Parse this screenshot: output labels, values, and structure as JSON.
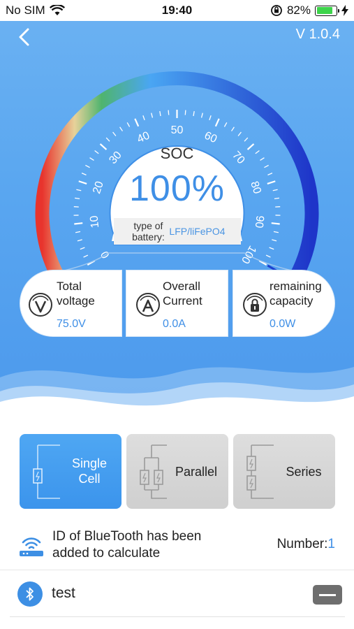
{
  "status_bar": {
    "carrier": "No SIM",
    "time": "19:40",
    "battery_percent": "82%",
    "battery_level": 0.82
  },
  "header": {
    "version": "V 1.0.4",
    "back_icon": "chevron-left-icon"
  },
  "gauge": {
    "label": "SOC",
    "value": "100%",
    "soc_percent": 100,
    "ticks": [
      "0",
      "10",
      "20",
      "30",
      "40",
      "50",
      "60",
      "70",
      "80",
      "90",
      "100"
    ],
    "battery_type_label": "type of battery:",
    "battery_type_value": "LFP/liFePO4",
    "colors": {
      "arc_start": "#e8342d",
      "arc_mid": "#4aa6f3",
      "arc_end": "#1e35c9",
      "value_text": "#3f8fe6"
    }
  },
  "stats": [
    {
      "title": "Total voltage",
      "value": "75.0V",
      "icon": "voltage-icon"
    },
    {
      "title": "Overall Current",
      "value": "0.0A",
      "icon": "current-icon"
    },
    {
      "title": "remaining capacity",
      "value": "0.0W",
      "icon": "capacity-lock-icon"
    }
  ],
  "modes": [
    {
      "label": "Single Cell",
      "active": true,
      "icon": "single-cell-diagram-icon"
    },
    {
      "label": "Parallel",
      "active": false,
      "icon": "parallel-diagram-icon"
    },
    {
      "label": "Series",
      "active": false,
      "icon": "series-diagram-icon"
    }
  ],
  "bluetooth": {
    "text": "ID of BlueTooth has been added to calculate",
    "number_label": "Number:",
    "number_value": "1",
    "icon": "router-icon"
  },
  "devices": [
    {
      "name": "test",
      "icon": "bluetooth-icon",
      "action_icon": "minus-icon"
    }
  ],
  "colors": {
    "accent": "#3f8fe6",
    "background_top": "#6cb2f2",
    "mode_active": "#4fa7f3",
    "mode_inactive": "#d8d8d8"
  }
}
